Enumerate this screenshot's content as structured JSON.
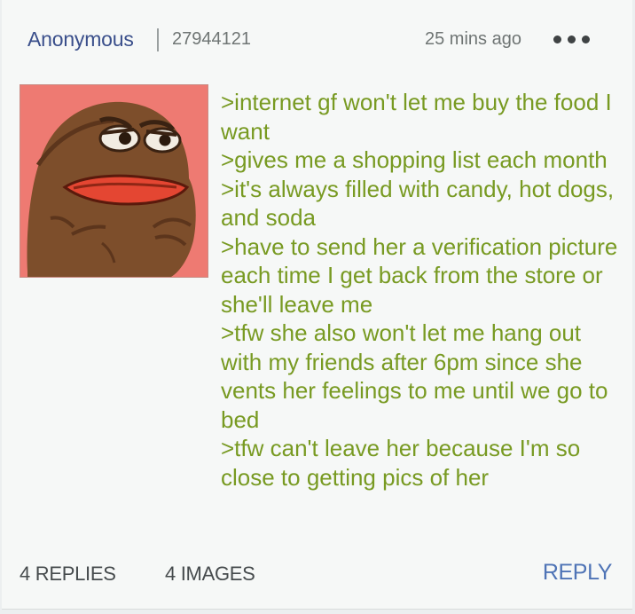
{
  "post": {
    "author": "Anonymous",
    "id": "27944121",
    "timestamp": "25 mins ago",
    "menu_icon": "more-horizontal-icon",
    "image_alt": "angry pepe frog reaction image",
    "lines": [
      ">internet gf won't let me buy the food I want",
      ">gives me a shopping list each month",
      ">it's always filled with candy, hot dogs, and soda",
      ">have to send her a verification picture each time I get back from the store or she'll leave me",
      ">tfw she also won't let me hang out with my friends after 6pm since she vents her feelings to me until we go to bed",
      ">tfw can't leave her because I'm so close to getting pics of her"
    ]
  },
  "footer": {
    "replies": "4 REPLIES",
    "images": "4 IMAGES",
    "reply_label": "REPLY"
  },
  "colors": {
    "greentext": "#789a22",
    "author": "#3a4f8b",
    "reply": "#4f74b6",
    "thumbnail_bg": "#ee7a72"
  }
}
